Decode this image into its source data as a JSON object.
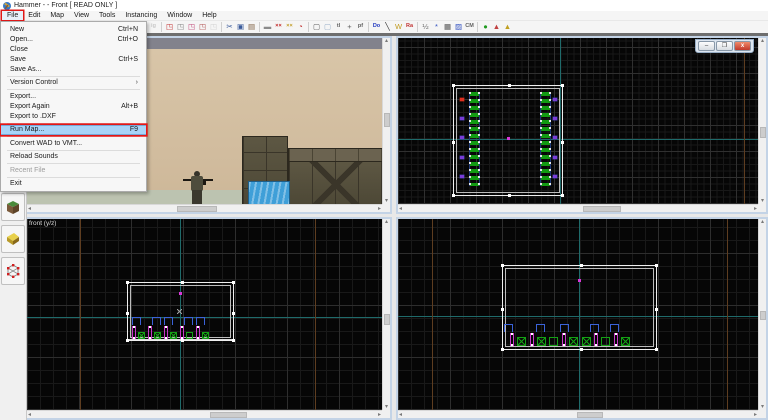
{
  "titlebar": {
    "title": "Hammer - - Front [ READ ONLY ]"
  },
  "menubar": {
    "items": [
      {
        "name": "menu-file",
        "label": "File",
        "annotated": true
      },
      {
        "name": "menu-edit",
        "label": "Edit"
      },
      {
        "name": "menu-map",
        "label": "Map"
      },
      {
        "name": "menu-view",
        "label": "View"
      },
      {
        "name": "menu-tools",
        "label": "Tools"
      },
      {
        "name": "menu-instancing",
        "label": "Instancing"
      },
      {
        "name": "menu-window",
        "label": "Window"
      },
      {
        "name": "menu-help",
        "label": "Help"
      }
    ]
  },
  "file_menu": {
    "items": [
      {
        "name": "file-menu-new",
        "label": "New",
        "shortcut": "Ctrl+N",
        "type": "item"
      },
      {
        "name": "file-menu-open",
        "label": "Open...",
        "shortcut": "Ctrl+O",
        "type": "item"
      },
      {
        "name": "file-menu-close",
        "label": "Close",
        "type": "item"
      },
      {
        "name": "file-menu-save",
        "label": "Save",
        "shortcut": "Ctrl+S",
        "type": "item"
      },
      {
        "name": "file-menu-save-as",
        "label": "Save As...",
        "type": "item"
      },
      {
        "type": "separator"
      },
      {
        "name": "file-menu-version-control",
        "label": "Version Control",
        "type": "item",
        "submenu": true
      },
      {
        "type": "separator"
      },
      {
        "name": "file-menu-export",
        "label": "Export...",
        "type": "item"
      },
      {
        "name": "file-menu-export-again",
        "label": "Export Again",
        "shortcut": "Alt+B",
        "type": "item"
      },
      {
        "name": "file-menu-export-dxf",
        "label": "Export to .DXF",
        "type": "item"
      },
      {
        "type": "separator"
      },
      {
        "name": "file-menu-run-map",
        "label": "Run Map...",
        "shortcut": "F9",
        "type": "item",
        "state": "highlighted",
        "annotated": true
      },
      {
        "type": "separator"
      },
      {
        "name": "file-menu-convert-wad",
        "label": "Convert WAD to VMT...",
        "type": "item"
      },
      {
        "type": "separator"
      },
      {
        "name": "file-menu-reload-sounds",
        "label": "Reload Sounds",
        "type": "item"
      },
      {
        "type": "separator"
      },
      {
        "name": "file-menu-recent-file",
        "label": "Recent File",
        "type": "item",
        "state": "disabled"
      },
      {
        "type": "separator"
      },
      {
        "name": "file-menu-exit",
        "label": "Exit",
        "type": "item"
      }
    ]
  },
  "toolbar": {
    "icons": [
      {
        "name": "redo-icon",
        "glyph": "ig",
        "color": "#9a9a9a",
        "type": "icon",
        "state": "disabled"
      },
      {
        "type": "separator"
      },
      {
        "name": "carve-icon",
        "glyph": "◳",
        "color": "#c03030",
        "type": "icon"
      },
      {
        "name": "hollow-icon",
        "glyph": "◳",
        "color": "#808080",
        "type": "icon"
      },
      {
        "name": "group-icon",
        "glyph": "◳",
        "color": "#c04878",
        "type": "icon"
      },
      {
        "name": "ungroup-icon",
        "glyph": "◳",
        "color": "#b05050",
        "type": "icon"
      },
      {
        "name": "ignore-groups-icon",
        "glyph": "◳",
        "color": "#b0b0b0",
        "type": "icon",
        "state": "disabled"
      },
      {
        "type": "separator"
      },
      {
        "name": "cut-icon",
        "glyph": "✂",
        "color": "#3a5a9a",
        "type": "icon"
      },
      {
        "name": "copy-icon",
        "glyph": "▣",
        "color": "#3a5a9a",
        "type": "icon"
      },
      {
        "name": "paste-icon",
        "glyph": "▤",
        "color": "#7a5a3a",
        "type": "icon"
      },
      {
        "type": "separator"
      },
      {
        "name": "hide-selected-icon",
        "glyph": "▬",
        "color": "#8a8a8a",
        "type": "icon"
      },
      {
        "name": "hide-unselected-icon",
        "glyph": "××",
        "color": "#c02020",
        "type": "icon"
      },
      {
        "name": "show-hidden-icon",
        "glyph": "××",
        "color": "#c09a20",
        "type": "icon"
      },
      {
        "name": "radius-culling-icon",
        "glyph": "◔",
        "color": "#c03030",
        "type": "icon"
      },
      {
        "type": "separator"
      },
      {
        "name": "select-box-icon",
        "glyph": "▢",
        "color": "#606060",
        "type": "icon"
      },
      {
        "name": "magnify-box-icon",
        "glyph": "▢",
        "color": "#9ab0c8",
        "type": "icon"
      },
      {
        "name": "texture-lock-icon",
        "glyph": "tl",
        "color": "#606060",
        "type": "icon"
      },
      {
        "name": "translate-icon",
        "glyph": "+",
        "color": "#606060",
        "type": "icon"
      },
      {
        "name": "displacement-mask-icon",
        "glyph": "pf",
        "color": "#606060",
        "type": "icon"
      },
      {
        "type": "separator"
      },
      {
        "name": "entity-names-icon",
        "glyph": "Do",
        "color": "#2038c0",
        "type": "icon"
      },
      {
        "name": "line-tool-icon",
        "glyph": "╲",
        "color": "#303030",
        "type": "icon"
      },
      {
        "name": "wireframe-icon",
        "glyph": "W",
        "color": "#c09a20",
        "type": "icon"
      },
      {
        "name": "helpers-icon",
        "glyph": "Ra",
        "color": "#c03030",
        "type": "icon"
      },
      {
        "type": "separator"
      },
      {
        "name": "split-view-icon",
        "glyph": "½",
        "color": "#707070",
        "type": "icon"
      },
      {
        "name": "options-icon",
        "glyph": "*",
        "color": "#3050c0",
        "type": "icon"
      },
      {
        "name": "grid-toggle-icon",
        "glyph": "▦",
        "color": "#505050",
        "type": "icon"
      },
      {
        "name": "grid3d-toggle-icon",
        "glyph": "▨",
        "color": "#3050c0",
        "type": "icon"
      },
      {
        "name": "cm-icon",
        "glyph": "CM",
        "color": "#606060",
        "type": "icon"
      },
      {
        "type": "separator"
      },
      {
        "name": "model-render-icon",
        "glyph": "●",
        "color": "#1f9a1f",
        "type": "icon"
      },
      {
        "name": "fade-preview-icon",
        "glyph": "▲",
        "color": "#c04040",
        "type": "icon"
      },
      {
        "name": "no-fade-icon",
        "glyph": "▲",
        "color": "#c0a020",
        "type": "icon"
      }
    ]
  },
  "sidebar": {
    "tools": [
      {
        "name": "texture-application-tool"
      },
      {
        "name": "displacement-tool"
      },
      {
        "name": "vertex-manipulation-tool"
      }
    ]
  },
  "viewports": {
    "bottom_left": {
      "label": "front (y/z)"
    },
    "window_buttons": [
      {
        "name": "viewport-minimize-button",
        "glyph": "–"
      },
      {
        "name": "viewport-restore-button",
        "glyph": "❐"
      },
      {
        "name": "viewport-close-button",
        "glyph": "x",
        "close": true
      }
    ]
  },
  "colors": {
    "annotation_red": "#e41818",
    "highlight_blue": "#a8d4f8",
    "grid_teal": "#1f6b6b",
    "grid_brown": "#5e3d20",
    "entity_green": "#14a014",
    "entity_magenta": "#c838c8",
    "entity_blue": "#3a62d8"
  }
}
